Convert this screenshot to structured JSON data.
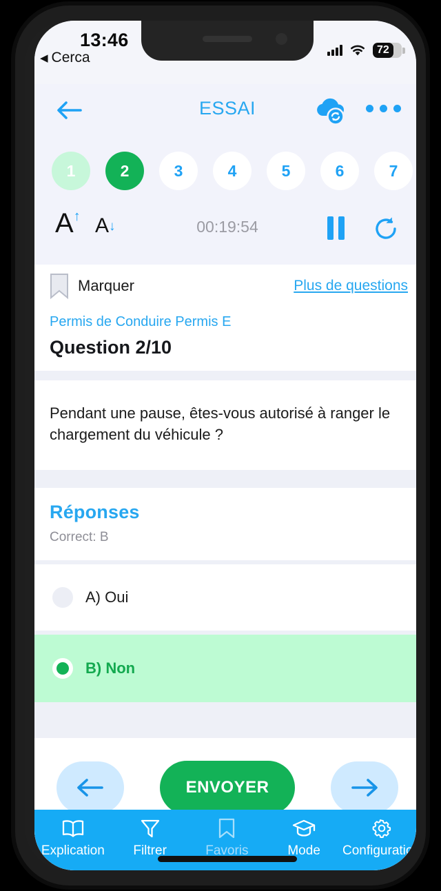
{
  "status_bar": {
    "time": "13:46",
    "back_app_label": "Cerca",
    "back_triangle": "◀",
    "battery_level": "72",
    "wifi_icon": "wifi-icon",
    "signal_icon": "cellular-signal-icon"
  },
  "header": {
    "back_icon": "arrow-left-icon",
    "title": "ESSAI",
    "cloud_sync_icon": "cloud-sync-icon",
    "more_icon": "more-options-icon",
    "question_pills": [
      {
        "label": "1",
        "state": "answered"
      },
      {
        "label": "2",
        "state": "current"
      },
      {
        "label": "3",
        "state": "plain"
      },
      {
        "label": "4",
        "state": "plain"
      },
      {
        "label": "5",
        "state": "plain"
      },
      {
        "label": "6",
        "state": "plain"
      },
      {
        "label": "7",
        "state": "plain"
      }
    ],
    "toolbar": {
      "font_increase_letter": "A",
      "font_increase_arrow": "↑",
      "font_decrease_letter": "A",
      "font_decrease_arrow": "↓",
      "timer": "00:19:54",
      "pause_icon": "pause-icon",
      "reload_icon": "refresh-icon"
    }
  },
  "question": {
    "mark_label": "Marquer",
    "bookmark_icon": "bookmark-icon",
    "more_questions_link": "Plus de questions",
    "category": "Permis de Conduire Permis E",
    "number": "Question 2/10",
    "text": "Pendant une pause, êtes-vous autorisé à ranger le chargement du véhicule ?"
  },
  "answers": {
    "heading": "Réponses",
    "correct_note": "Correct: B",
    "options": [
      {
        "label": "A) Oui",
        "selected": false
      },
      {
        "label": "B) Non",
        "selected": true
      }
    ]
  },
  "navigation": {
    "prev_icon": "arrow-left-icon",
    "next_icon": "arrow-right-icon",
    "submit_label": "ENVOYER"
  },
  "tabbar": {
    "items": [
      {
        "label": "Explication",
        "icon": "book-icon",
        "dim": false
      },
      {
        "label": "Filtrer",
        "icon": "funnel-icon",
        "dim": false
      },
      {
        "label": "Favoris",
        "icon": "bookmark-icon",
        "dim": true
      },
      {
        "label": "Mode",
        "icon": "graduation-cap-icon",
        "dim": false
      },
      {
        "label": "Configuration",
        "icon": "gear-icon",
        "dim": false
      }
    ]
  },
  "colors": {
    "accent_blue": "#1fa2f5",
    "tabbar_blue": "#16ABF5",
    "green": "#13b257",
    "green_light": "#bdfbd3",
    "pill_answered": "#c7f7da",
    "page_bg": "#eef0f7"
  }
}
